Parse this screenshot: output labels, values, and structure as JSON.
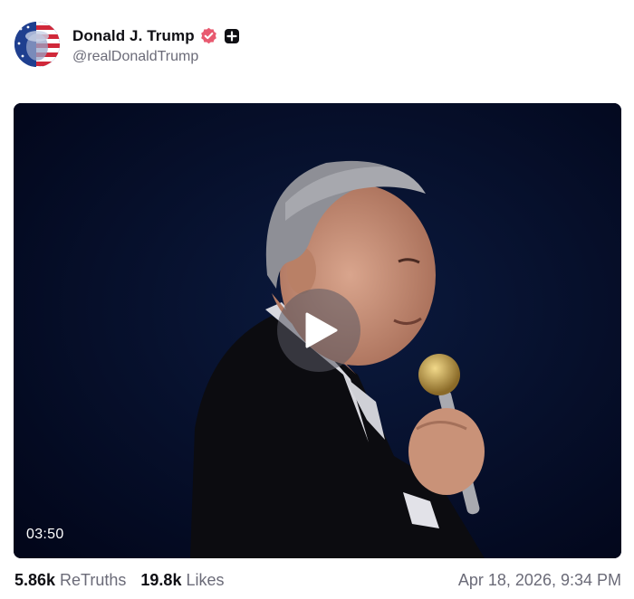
{
  "author": {
    "display_name": "Donald J. Trump",
    "handle": "@realDonaldTrump",
    "verified_icon": "verified-badge-icon",
    "plus_icon": "plus-badge-icon"
  },
  "media": {
    "duration": "03:50",
    "play_icon": "play-icon"
  },
  "stats": {
    "retruths_count": "5.86k",
    "retruths_label": "ReTruths",
    "likes_count": "19.8k",
    "likes_label": "Likes"
  },
  "timestamp": "Apr 18, 2026, 9:34 PM",
  "colors": {
    "verified": "#e85a70",
    "text_primary": "#0f0f14",
    "text_secondary": "#6b6b78"
  }
}
